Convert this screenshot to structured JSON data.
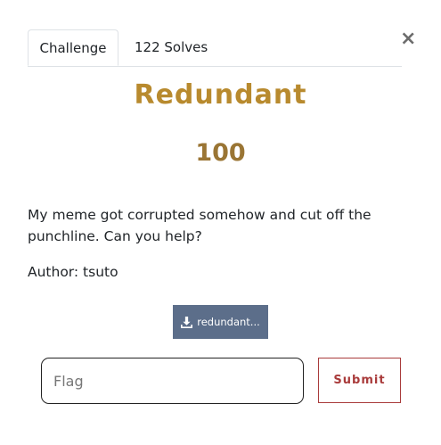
{
  "tabs": [
    {
      "label": "Challenge",
      "active": true
    },
    {
      "label": "122 Solves",
      "active": false
    }
  ],
  "close_label": "×",
  "challenge": {
    "name": "Redundant",
    "points": "100",
    "description": "My meme got corrupted somehow and cut off the punchline. Can you help?",
    "author": "Author: tsuto",
    "file_label": "redundant..."
  },
  "form": {
    "flag_placeholder": "Flag",
    "flag_value": "",
    "submit_label": "Submit"
  },
  "colors": {
    "title": "#b88a2e",
    "points": "#9a7534",
    "file_button": "#5c6e8a",
    "submit": "#a93b3b"
  },
  "icons": {
    "download": "download-icon",
    "close": "close-icon"
  }
}
